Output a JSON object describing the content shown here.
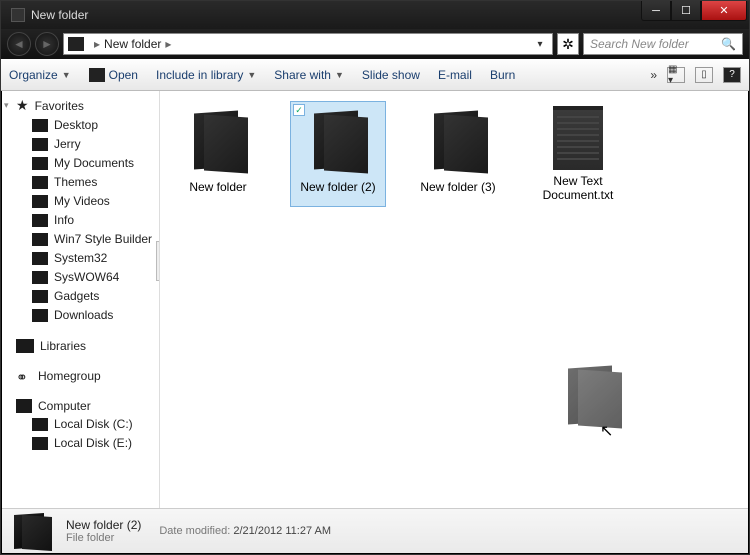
{
  "window": {
    "title": "New folder"
  },
  "breadcrumb": {
    "location": "New folder"
  },
  "search": {
    "placeholder": "Search New folder"
  },
  "toolbar": {
    "organize": "Organize",
    "open": "Open",
    "include": "Include in library",
    "share": "Share with",
    "slideshow": "Slide show",
    "email": "E-mail",
    "burn": "Burn"
  },
  "sidebar": {
    "favorites": "Favorites",
    "fav_items": [
      "Desktop",
      "Jerry",
      "My Documents",
      "Themes",
      "My Videos",
      "Info",
      "Win7 Style Builder",
      "System32",
      "SysWOW64",
      "Gadgets",
      "Downloads"
    ],
    "libraries": "Libraries",
    "homegroup": "Homegroup",
    "computer": "Computer",
    "drives": [
      "Local Disk (C:)",
      "Local Disk (E:)"
    ]
  },
  "items": [
    {
      "name": "New folder",
      "type": "folder",
      "selected": false
    },
    {
      "name": "New folder (2)",
      "type": "folder",
      "selected": true
    },
    {
      "name": "New folder (3)",
      "type": "folder",
      "selected": false
    },
    {
      "name": "New Text Document.txt",
      "type": "text",
      "selected": false
    }
  ],
  "details": {
    "name": "New folder (2)",
    "type": "File folder",
    "modified_label": "Date modified:",
    "modified_value": "2/21/2012 11:27 AM"
  }
}
